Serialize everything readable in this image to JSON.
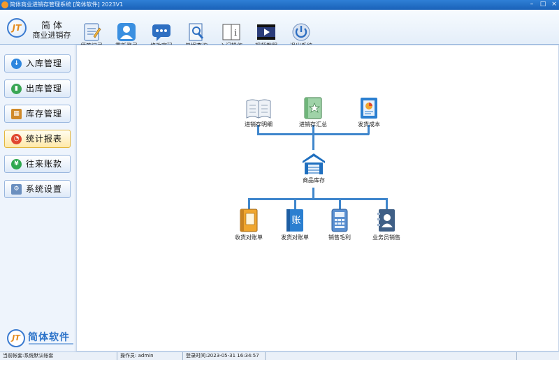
{
  "window": {
    "title": "简体商业进销存管理系统 [简体软件] 2023V1"
  },
  "logo": {
    "line1": "简体",
    "line2": "商业进销存",
    "mark": "JT"
  },
  "toolbar": [
    {
      "label": "便签记录",
      "icon": "notepad-icon"
    },
    {
      "label": "重新登录",
      "icon": "user-avatar-icon"
    },
    {
      "label": "修改密码",
      "icon": "chat-bubble-icon"
    },
    {
      "label": "单据查询",
      "icon": "search-document-icon"
    },
    {
      "label": "入门操作",
      "icon": "info-book-icon"
    },
    {
      "label": "视频教程",
      "icon": "video-play-icon"
    },
    {
      "label": "退出系统",
      "icon": "power-icon"
    }
  ],
  "sidebar": {
    "items": [
      {
        "label": "入库管理",
        "icon": "download-arrow-icon",
        "color": "#2e86de"
      },
      {
        "label": "出库管理",
        "icon": "bar-chart-icon",
        "color": "#3aa655"
      },
      {
        "label": "库存管理",
        "icon": "boxes-icon",
        "color": "#d08a2a"
      },
      {
        "label": "统计报表",
        "icon": "pie-chart-icon",
        "color": "#e0472f"
      },
      {
        "label": "往来账款",
        "icon": "yen-coin-icon",
        "color": "#2fa84f"
      },
      {
        "label": "系统设置",
        "icon": "gear-icon",
        "color": "#6a8fbf"
      }
    ],
    "brand": {
      "mark": "JT",
      "text": "简体软件"
    }
  },
  "flow": {
    "top": [
      {
        "label": "进销存明细",
        "icon": "open-book-icon"
      },
      {
        "label": "进销存汇总",
        "icon": "star-book-icon"
      },
      {
        "label": "发货成本",
        "icon": "pie-report-icon"
      }
    ],
    "center": {
      "label": "商品库存",
      "icon": "warehouse-icon"
    },
    "bottom": [
      {
        "label": "收货对账单",
        "icon": "ledger-icon"
      },
      {
        "label": "发货对账单",
        "icon": "account-book-icon"
      },
      {
        "label": "销售毛利",
        "icon": "calculator-icon"
      },
      {
        "label": "业务员销售",
        "icon": "contact-book-icon"
      }
    ],
    "accent": "#3f86cc"
  },
  "status": {
    "account": "当前帐套:系统默认帐套",
    "operator": "操作员: admin",
    "login_time": "登录时间:2023-05-31 16:34:57"
  }
}
